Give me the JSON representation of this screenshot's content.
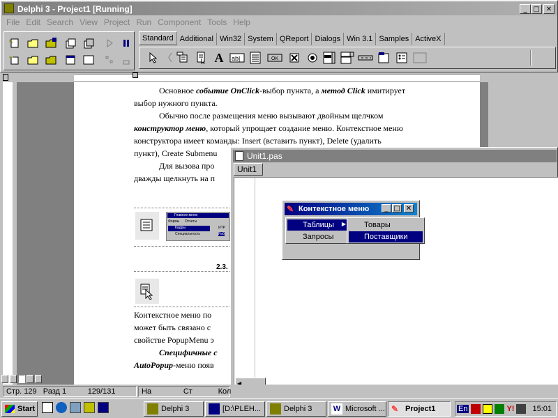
{
  "delphi": {
    "title": "Delphi 3 - Project1 [Running]",
    "menu": [
      "File",
      "Edit",
      "Search",
      "View",
      "Project",
      "Run",
      "Component",
      "Tools",
      "Help"
    ],
    "tabs": [
      "Standard",
      "Additional",
      "Win32",
      "System",
      "QReport",
      "Dialogs",
      "Win 3.1",
      "Samples",
      "ActiveX"
    ],
    "active_tab": "Standard"
  },
  "document": {
    "paragraphs": [
      {
        "prefix": "Основное ",
        "bold1": "событие OnClick",
        "mid": "-выбор пункта, а ",
        "bold2": "метод Click",
        "suffix": " имитирует"
      },
      "выбор нужного пункта.",
      "Обычно после размещения меню вызывают двойным щелчком",
      {
        "bold": "конструктор меню",
        "rest": ", который упрощает создание меню. Контекстное меню"
      },
      "конструктора имеет команды: Insert (вставить пункт), Delete (удалить",
      "пункт), Create Submenu",
      "Для вызова про",
      "дважды щелкнуть на п"
    ],
    "section_label": "2.3.",
    "lower_lines": [
      "Контекстное меню по",
      "может быть связано с",
      "свойстве PopupMenu э"
    ],
    "specific_bold": "Специфичные с",
    "autopopup_bold": "AutoPopup",
    "autopopup_rest": "-меню появ",
    "thumb_title": "Главное меню",
    "thumb_menu": [
      "Формы",
      "Отчеты"
    ],
    "thumb_items": [
      "Кадры",
      "Специальность"
    ],
    "thumb_side": [
      "ИТР",
      "Раб"
    ]
  },
  "unit1": {
    "title": "Unit1.pas",
    "tab": "Unit1"
  },
  "context_form": {
    "title": "Контекстное меню",
    "menu_items": [
      "Таблицы",
      "Запросы"
    ],
    "submenu_items": [
      "Товары",
      "Поставщики"
    ]
  },
  "word_status": {
    "page": "Стр.",
    "page_num": "129",
    "section": "Разд",
    "section_num": "1",
    "pages": "129/131",
    "at": "На",
    "line": "Ст",
    "col": "Кол"
  },
  "taskbar": {
    "start": "Start",
    "tasks": [
      "Delphi 3",
      "[D:\\PLEH...",
      "Delphi 3",
      "Microsoft ...",
      "Project1"
    ],
    "lang": "En",
    "time": "15:01"
  }
}
